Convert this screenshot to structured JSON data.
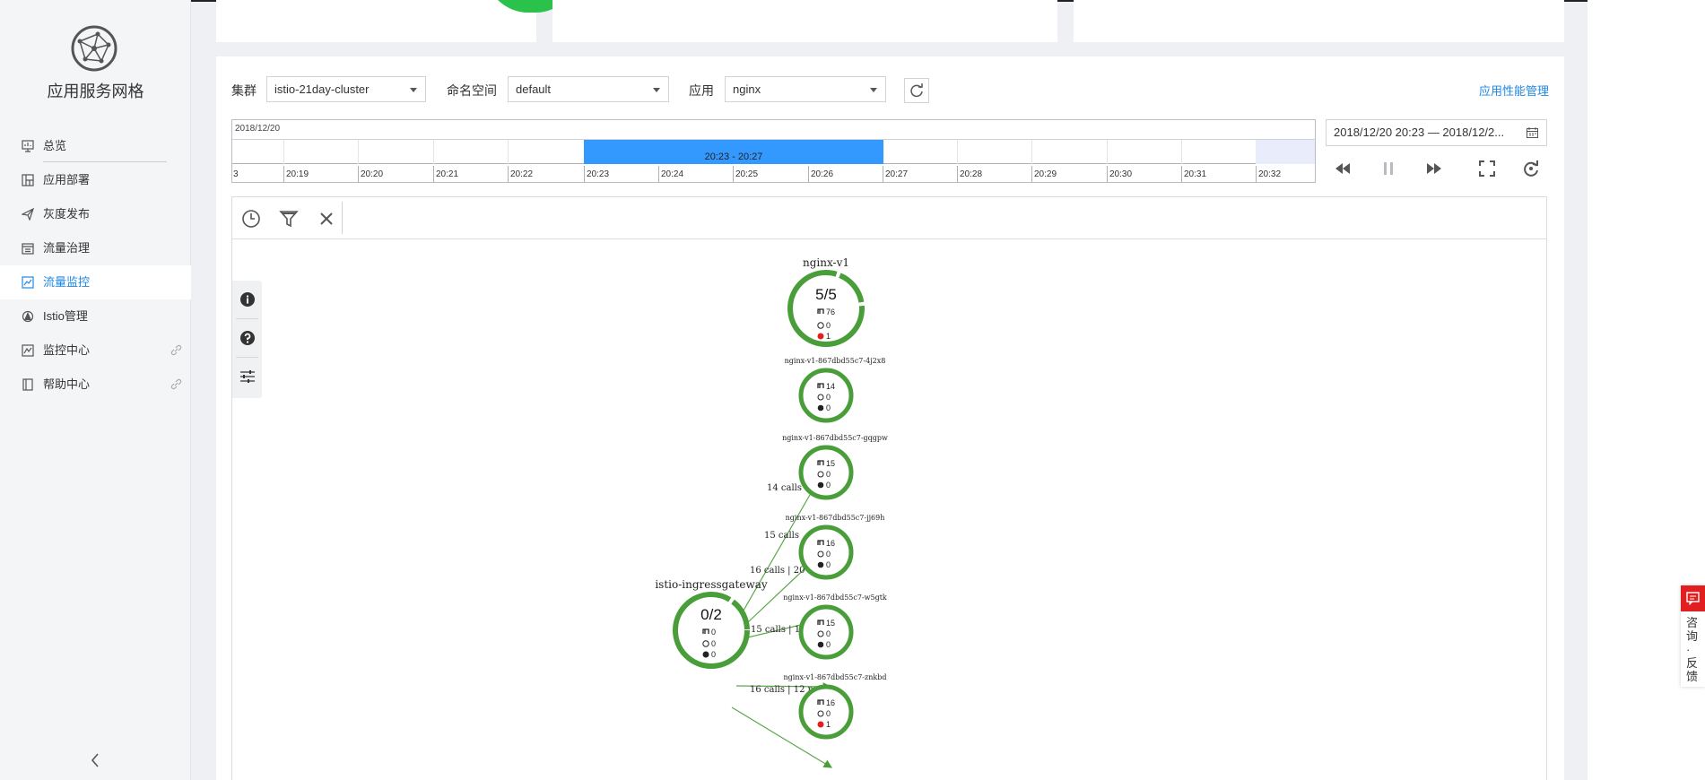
{
  "app": {
    "brand": "应用服务网格"
  },
  "sidebar": {
    "items": [
      {
        "label": "总览",
        "icon": "dashboard-icon",
        "active": false,
        "external": false
      },
      {
        "label": "应用部署",
        "icon": "layout-icon",
        "active": false,
        "external": false
      },
      {
        "label": "灰度发布",
        "icon": "paper-plane-icon",
        "active": false,
        "external": false
      },
      {
        "label": "流量治理",
        "icon": "table-icon",
        "active": false,
        "external": false
      },
      {
        "label": "流量监控",
        "icon": "line-chart-icon",
        "active": true,
        "external": false
      },
      {
        "label": "Istio管理",
        "icon": "istio-icon",
        "active": false,
        "external": false
      },
      {
        "label": "监控中心",
        "icon": "monitor-chart-icon",
        "active": false,
        "external": true
      },
      {
        "label": "帮助中心",
        "icon": "book-icon",
        "active": false,
        "external": true
      }
    ]
  },
  "filters": {
    "cluster_label": "集群",
    "cluster_value": "istio-21day-cluster",
    "namespace_label": "命名空间",
    "namespace_value": "default",
    "app_label": "应用",
    "app_value": "nginx",
    "apm_link": "应用性能管理"
  },
  "timeline": {
    "date": "2018/12/20",
    "selection_label": "20:23 - 20:27",
    "ticks": [
      "3",
      "20:19",
      "20:20",
      "20:21",
      "20:22",
      "20:23",
      "20:24",
      "20:25",
      "20:26",
      "20:27",
      "20:28",
      "20:29",
      "20:30",
      "20:31",
      "20:32"
    ],
    "range_text": "2018/12/20 20:23 — 2018/12/2..."
  },
  "graph": {
    "root": {
      "name": "nginx-v1",
      "ratio": "5/5",
      "requests": "76",
      "latency": "0",
      "errors": "1"
    },
    "gateway": {
      "name": "istio-ingressgateway",
      "ratio": "0/2",
      "requests": "0",
      "latency": "0",
      "errors": "0"
    },
    "pods": [
      {
        "name": "nginx-v1-867dbd55c7-4j2x8",
        "requests": "14",
        "latency": "0",
        "errors": "0"
      },
      {
        "name": "nginx-v1-867dbd55c7-gqgpw",
        "requests": "15",
        "latency": "0",
        "errors": "0"
      },
      {
        "name": "nginx-v1-867dbd55c7-jj69h",
        "requests": "16",
        "latency": "0",
        "errors": "0"
      },
      {
        "name": "nginx-v1-867dbd55c7-w5gtk",
        "requests": "15",
        "latency": "0",
        "errors": "0"
      },
      {
        "name": "nginx-v1-867dbd55c7-znkbd",
        "requests": "16",
        "latency": "0",
        "errors": "1"
      }
    ],
    "edges": [
      {
        "label": "14 calls"
      },
      {
        "label": "15 calls"
      },
      {
        "label": "16 calls | 20 n"
      },
      {
        "label": "15 calls | 14"
      },
      {
        "label": "16 calls | 12 n"
      }
    ]
  },
  "feedback": {
    "text": "咨询·反馈"
  },
  "colors": {
    "accent": "#1e88e5",
    "node": "#4a9e3a",
    "selection": "#3399ff",
    "error": "#e02020"
  }
}
